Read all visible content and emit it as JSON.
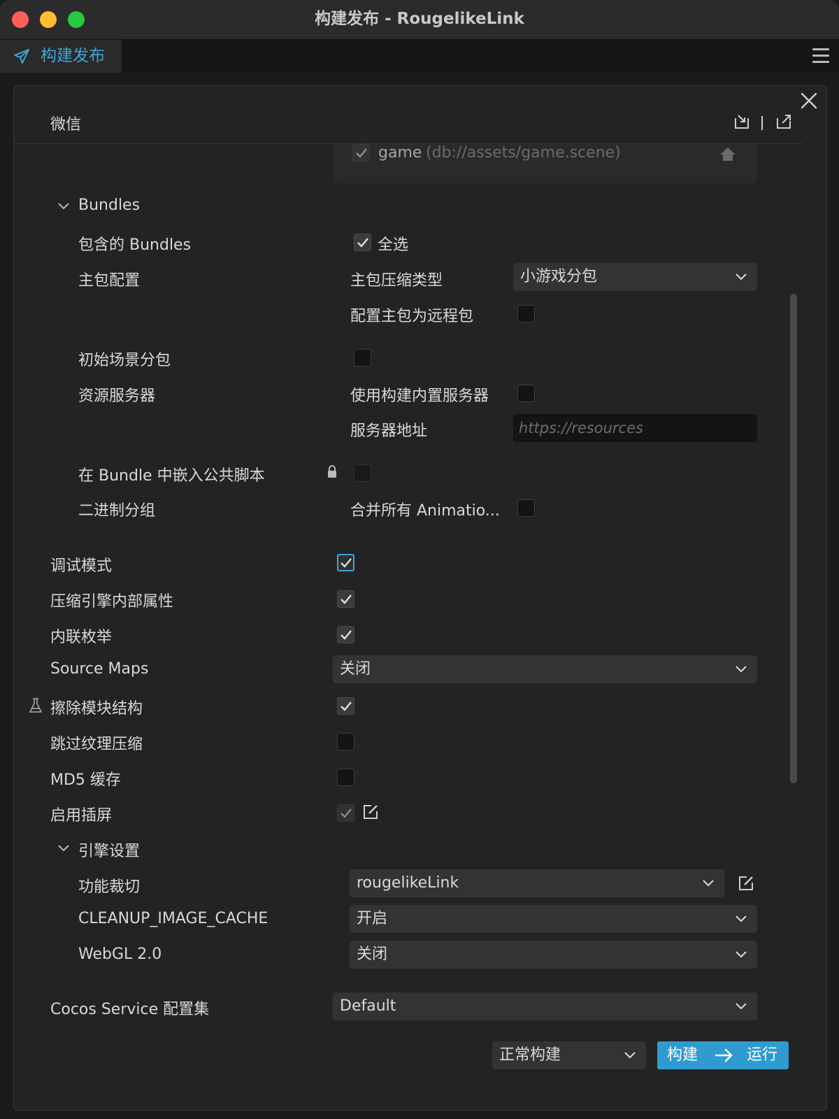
{
  "window": {
    "title": "构建发布 - RougelikeLink"
  },
  "tabstrip": {
    "tab_label": "构建发布"
  },
  "header": {
    "title": "微信"
  },
  "scene": {
    "name": "game",
    "path": "(db://assets/game.scene)"
  },
  "bundles": {
    "section_label": "Bundles",
    "included_label": "包含的 Bundles",
    "select_all_label": "全选",
    "main_config_label": "主包配置",
    "compress_type_label": "主包压缩类型",
    "compress_type_value": "小游戏分包",
    "remote_main_label": "配置主包为远程包",
    "initial_scene_label": "初始场景分包",
    "resource_server_label": "资源服务器",
    "builtin_server_label": "使用构建内置服务器",
    "server_addr_label": "服务器地址",
    "server_addr_placeholder": "https://resources",
    "embed_script_label": "在 Bundle 中嵌入公共脚本",
    "binary_group_label": "二进制分组",
    "merge_anim_label": "合并所有 Animatio..."
  },
  "options": {
    "debug_label": "调试模式",
    "mangle_label": "压缩引擎内部属性",
    "inline_enum_label": "内联枚举",
    "source_maps_label": "Source Maps",
    "source_maps_value": "关闭",
    "erase_modules_label": "擦除模块结构",
    "skip_texture_label": "跳过纹理压缩",
    "md5_label": "MD5 缓存",
    "splash_label": "启用插屏"
  },
  "engine": {
    "section_label": "引擎设置",
    "feature_cut_label": "功能裁切",
    "feature_cut_value": "rougelikeLink",
    "cleanup_label": "CLEANUP_IMAGE_CACHE",
    "cleanup_value": "开启",
    "webgl_label": "WebGL 2.0",
    "webgl_value": "关闭"
  },
  "cocos_service": {
    "label": "Cocos Service 配置集",
    "value": "Default"
  },
  "footer": {
    "build_mode_value": "正常构建",
    "build_label": "构建",
    "run_label": "运行"
  }
}
